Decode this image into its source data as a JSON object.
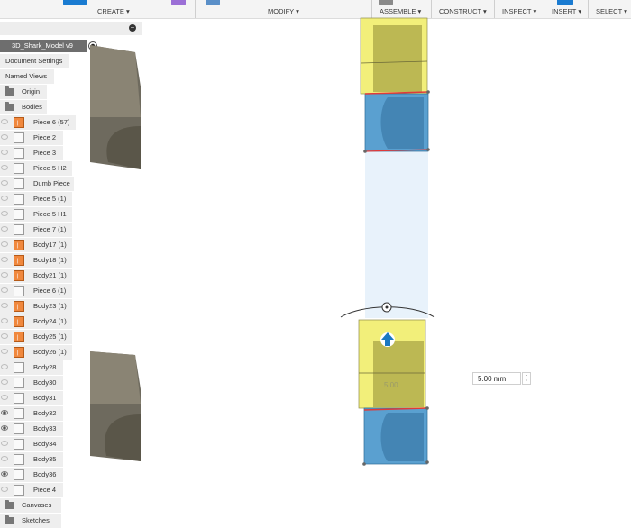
{
  "toolbar": {
    "groups": [
      {
        "label": "CREATE ▾"
      },
      {
        "label": "MODIFY ▾"
      },
      {
        "label": "ASSEMBLE ▾"
      },
      {
        "label": "CONSTRUCT ▾"
      },
      {
        "label": "INSPECT ▾"
      },
      {
        "label": "INSERT ▾"
      },
      {
        "label": "SELECT ▾"
      }
    ],
    "accent": "#1a7bd1"
  },
  "browser": {
    "root": "3D_Shark_Model v9",
    "items": [
      {
        "label": "Document Settings"
      },
      {
        "label": "Named Views"
      },
      {
        "label": "Origin"
      },
      {
        "label": "Bodies"
      },
      {
        "label": "Piece 6 (57)"
      },
      {
        "label": "Piece 2"
      },
      {
        "label": "Piece 3"
      },
      {
        "label": "Piece 5 H2"
      },
      {
        "label": "Dumb Piece"
      },
      {
        "label": "Piece 5 (1)"
      },
      {
        "label": "Piece 5 H1"
      },
      {
        "label": "Piece 7 (1)"
      },
      {
        "label": "Body17 (1)"
      },
      {
        "label": "Body18 (1)"
      },
      {
        "label": "Body21 (1)"
      },
      {
        "label": "Piece 6 (1)"
      },
      {
        "label": "Body23 (1)"
      },
      {
        "label": "Body24 (1)"
      },
      {
        "label": "Body25 (1)"
      },
      {
        "label": "Body26 (1)"
      },
      {
        "label": "Body28"
      },
      {
        "label": "Body30"
      },
      {
        "label": "Body31"
      },
      {
        "label": "Body32"
      },
      {
        "label": "Body33"
      },
      {
        "label": "Body34"
      },
      {
        "label": "Body35"
      },
      {
        "label": "Body36"
      },
      {
        "label": "Piece 4"
      },
      {
        "label": "Canvases"
      },
      {
        "label": "Sketches"
      }
    ]
  },
  "viewport": {
    "dimension_input": "5.00 mm",
    "ghost_label": "5.00",
    "colors": {
      "yellow": "#f2ef7a",
      "blue": "#5aa0d0",
      "dark_body": "#6e6a5e",
      "red_edge": "#e03a3a"
    }
  }
}
